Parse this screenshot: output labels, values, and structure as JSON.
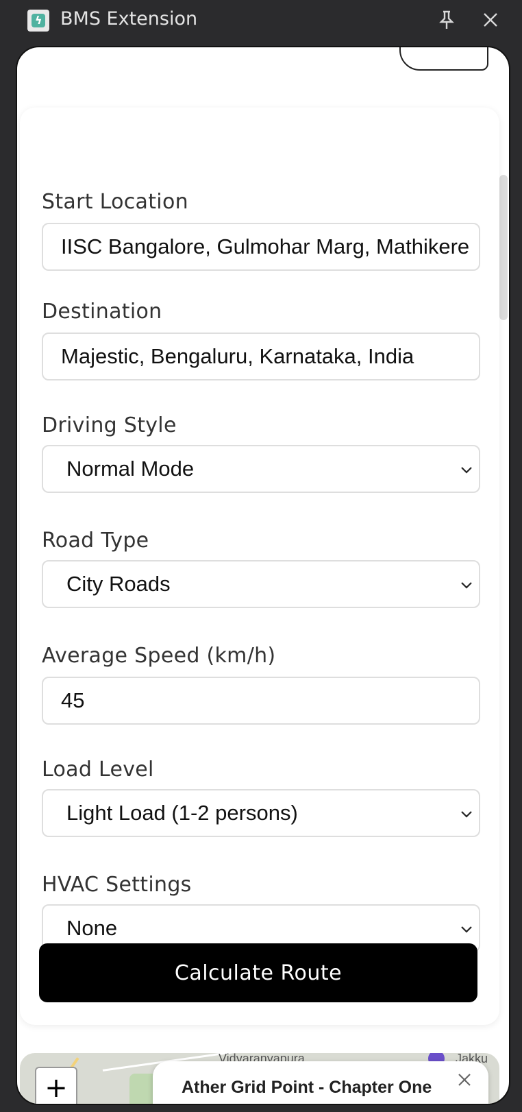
{
  "window": {
    "title": "BMS Extension"
  },
  "form": {
    "start_location": {
      "label": "Start Location",
      "value": "IISC Bangalore, Gulmohar Marg, Mathikere"
    },
    "destination": {
      "label": "Destination",
      "value": "Majestic, Bengaluru, Karnataka, India"
    },
    "driving_style": {
      "label": "Driving Style",
      "value": "Normal Mode"
    },
    "road_type": {
      "label": "Road Type",
      "value": "City Roads"
    },
    "average_speed": {
      "label": "Average Speed (km/h)",
      "value": "45"
    },
    "load_level": {
      "label": "Load Level",
      "value": "Light Load (1-2 persons)"
    },
    "hvac": {
      "label": "HVAC Settings",
      "value": "None"
    },
    "calculate_label": "Calculate Route"
  },
  "map": {
    "label_top": "Vidyaranyapura",
    "label_right": "Jakku",
    "zoom_in_label": "+",
    "popup_title": "Ather Grid Point - Chapter One"
  },
  "icons": {
    "app": "bolt-icon",
    "pin": "pin-icon",
    "close": "close-icon",
    "chevron": "chevron-down-icon"
  },
  "colors": {
    "title_bar": "#2b2b2d",
    "button": "#000000",
    "app_accent": "#4fb2a0"
  }
}
